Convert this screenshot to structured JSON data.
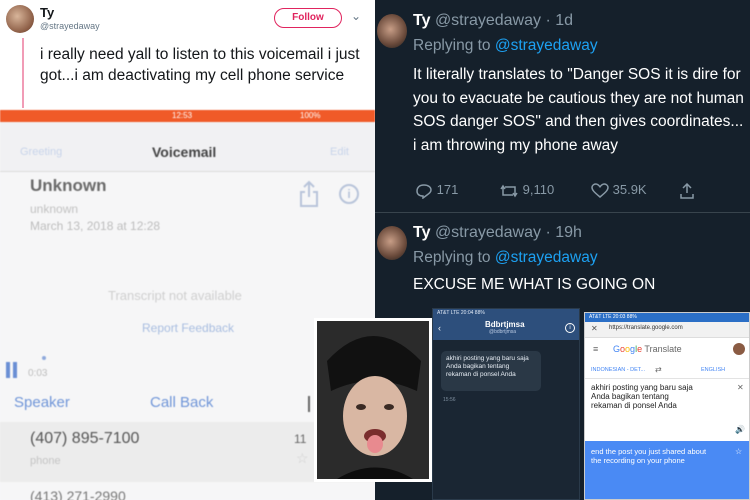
{
  "left_tweet": {
    "name": "Ty",
    "handle": "@strayedaway",
    "follow_label": "Follow",
    "text": "i really need yall to listen to this voicemail i just got...i am deactivating my cell phone service"
  },
  "voicemail": {
    "status_time": "12:53",
    "status_battery": "100%",
    "back_label": "Greeting",
    "title": "Voicemail",
    "edit_label": "Edit",
    "caller": "Unknown",
    "caller_sub": "unknown",
    "date": "March 13, 2018 at 12:28",
    "transcript": "Transcript not available",
    "report": "Report Feedback",
    "elapsed": "0:03",
    "speaker": "Speaker",
    "call_back": "Call Back",
    "phone1": "(407) 895-7100",
    "phone1_type": "phone",
    "phone1_time": "11",
    "phone2": "(413) 271-2990"
  },
  "dark_tweets": [
    {
      "name": "Ty",
      "meta": "@strayedaway · 1d",
      "replying": "Replying to",
      "reply_to": "@strayedaway",
      "text": "It literally translates to \"Danger SOS it is dire for you to evacuate be cautious they are not human SOS danger SOS\" and then gives coordinates... i am throwing my phone away",
      "replies": "171",
      "retweets": "9,110",
      "likes": "35.9K"
    },
    {
      "name": "Ty",
      "meta": "@strayedaway · 19h",
      "replying": "Replying to",
      "reply_to": "@strayedaway",
      "text": "EXCUSE ME WHAT IS GOING ON"
    }
  ],
  "messages_screen": {
    "status": "AT&T  LTE   20:04   88%",
    "title": "Bdbrtjmsa",
    "subtitle": "@bdbrtjmsa",
    "bubble": "akhiri posting yang baru saja Anda bagikan tentang rekaman di ponsel Anda",
    "timestamp": "15:56"
  },
  "translate_screen": {
    "status": "AT&T  LTE   20:03   88%",
    "url": "https://translate.google.com",
    "logo": "Google Translate",
    "source_lang": "INDONESIAN - DET...",
    "target_lang": "ENGLISH",
    "source_text": "akhiri posting yang baru saja Anda bagikan tentang rekaman di ponsel Anda",
    "output_text": "end the post you just shared about the recording on your phone"
  },
  "colors": {
    "twitter_red": "#e0245e",
    "dark_bg": "#15202b",
    "link_blue": "#1da1f2",
    "ios_blue": "#6f95d8"
  }
}
